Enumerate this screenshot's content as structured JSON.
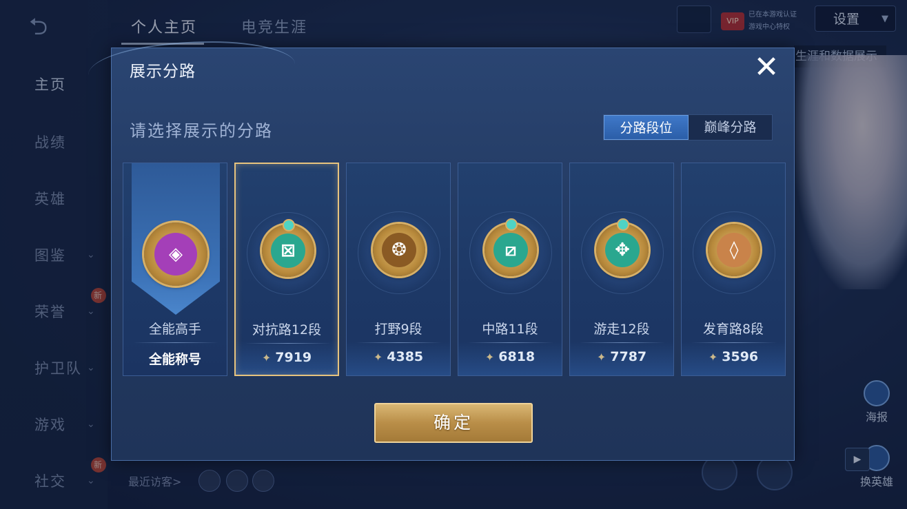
{
  "background": {
    "nav": {
      "back_icon": "back-arrow-icon",
      "items": [
        {
          "label": "主页",
          "active": true
        },
        {
          "label": "战绩"
        },
        {
          "label": "英雄"
        },
        {
          "label": "图鉴"
        },
        {
          "label": "荣誉",
          "badge": "新"
        },
        {
          "label": "护卫队"
        },
        {
          "label": "游戏"
        },
        {
          "label": "社交",
          "badge": "新"
        }
      ]
    },
    "tabs": [
      "个人主页",
      "电竞生涯"
    ],
    "vip": {
      "badge": "VIP",
      "line1": "已在本游戏认证",
      "line2": "游戏中心特权"
    },
    "settings_label": "设置",
    "partial_label": "生涯和数据展示",
    "poster_label": "海报",
    "swap_hero_label": "换英雄",
    "recent_visitors_label": "最近访客>"
  },
  "dialog": {
    "title": "展示分路",
    "close_icon": "close-icon",
    "subtitle": "请选择展示的分路",
    "toggle": {
      "options": [
        "分路段位",
        "巅峰分路"
      ],
      "active_index": 0
    },
    "cards": [
      {
        "name": "全能高手",
        "footer": "全能称号",
        "emblem_color": "#a43fb8",
        "glyph": "◈",
        "type": "title"
      },
      {
        "name": "对抗路12段",
        "points": "7919",
        "emblem_color": "#2aa78f",
        "glyph": "⊠",
        "selected": true
      },
      {
        "name": "打野9段",
        "points": "4385",
        "emblem_color": "#8a5a24",
        "glyph": "❂"
      },
      {
        "name": "中路11段",
        "points": "6818",
        "emblem_color": "#2aa78f",
        "glyph": "⧄"
      },
      {
        "name": "游走12段",
        "points": "7787",
        "emblem_color": "#2aa78f",
        "glyph": "✥"
      },
      {
        "name": "发育路8段",
        "points": "3596",
        "emblem_color": "#c9834a",
        "glyph": "◊"
      }
    ],
    "confirm_label": "确定"
  },
  "colors": {
    "accent_gold": "#e8c47e",
    "dialog_bg": "#22385f",
    "toggle_active": "#2b5ea8"
  }
}
